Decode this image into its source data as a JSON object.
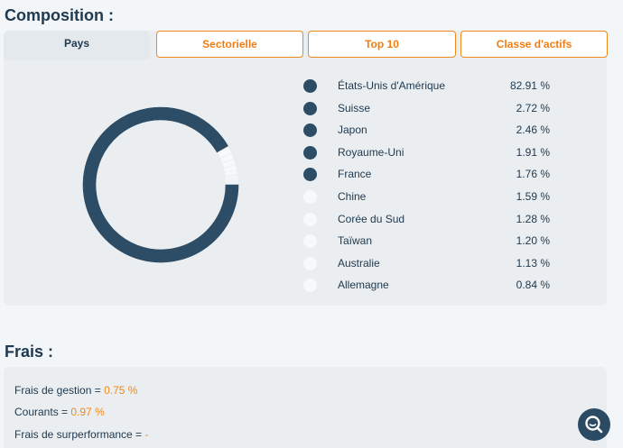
{
  "composition": {
    "title": "Composition :",
    "tabs": [
      {
        "label": "Pays",
        "active": true
      },
      {
        "label": "Sectorielle",
        "active": false
      },
      {
        "label": "Top 10",
        "active": false
      },
      {
        "label": "Classe d'actifs",
        "active": false
      }
    ],
    "colors": {
      "dark": "#2d4d66",
      "light": "#f7f9fa",
      "accent": "#f08a1c"
    },
    "countries": [
      {
        "label": "États-Unis d'Amérique",
        "value": "82.91 %",
        "pct": 82.91,
        "shade": "dark"
      },
      {
        "label": "Suisse",
        "value": "2.72 %",
        "pct": 2.72,
        "shade": "dark"
      },
      {
        "label": "Japon",
        "value": "2.46 %",
        "pct": 2.46,
        "shade": "dark"
      },
      {
        "label": "Royaume-Uni",
        "value": "1.91 %",
        "pct": 1.91,
        "shade": "dark"
      },
      {
        "label": "France",
        "value": "1.76 %",
        "pct": 1.76,
        "shade": "dark"
      },
      {
        "label": "Chine",
        "value": "1.59 %",
        "pct": 1.59,
        "shade": "light"
      },
      {
        "label": "Corée du Sud",
        "value": "1.28 %",
        "pct": 1.28,
        "shade": "light"
      },
      {
        "label": "Taïwan",
        "value": "1.20 %",
        "pct": 1.2,
        "shade": "light"
      },
      {
        "label": "Australie",
        "value": "1.13 %",
        "pct": 1.13,
        "shade": "light"
      },
      {
        "label": "Allemagne",
        "value": "0.84 %",
        "pct": 0.84,
        "shade": "light"
      }
    ]
  },
  "fees": {
    "title": "Frais :",
    "lines": [
      {
        "label": "Frais de gestion = ",
        "value": "0.75 %"
      },
      {
        "label": "Courants = ",
        "value": "0.97 %"
      },
      {
        "label": "Frais de surperformance = ",
        "value": "-"
      }
    ]
  },
  "fab": {
    "icon": "search-icon"
  }
}
